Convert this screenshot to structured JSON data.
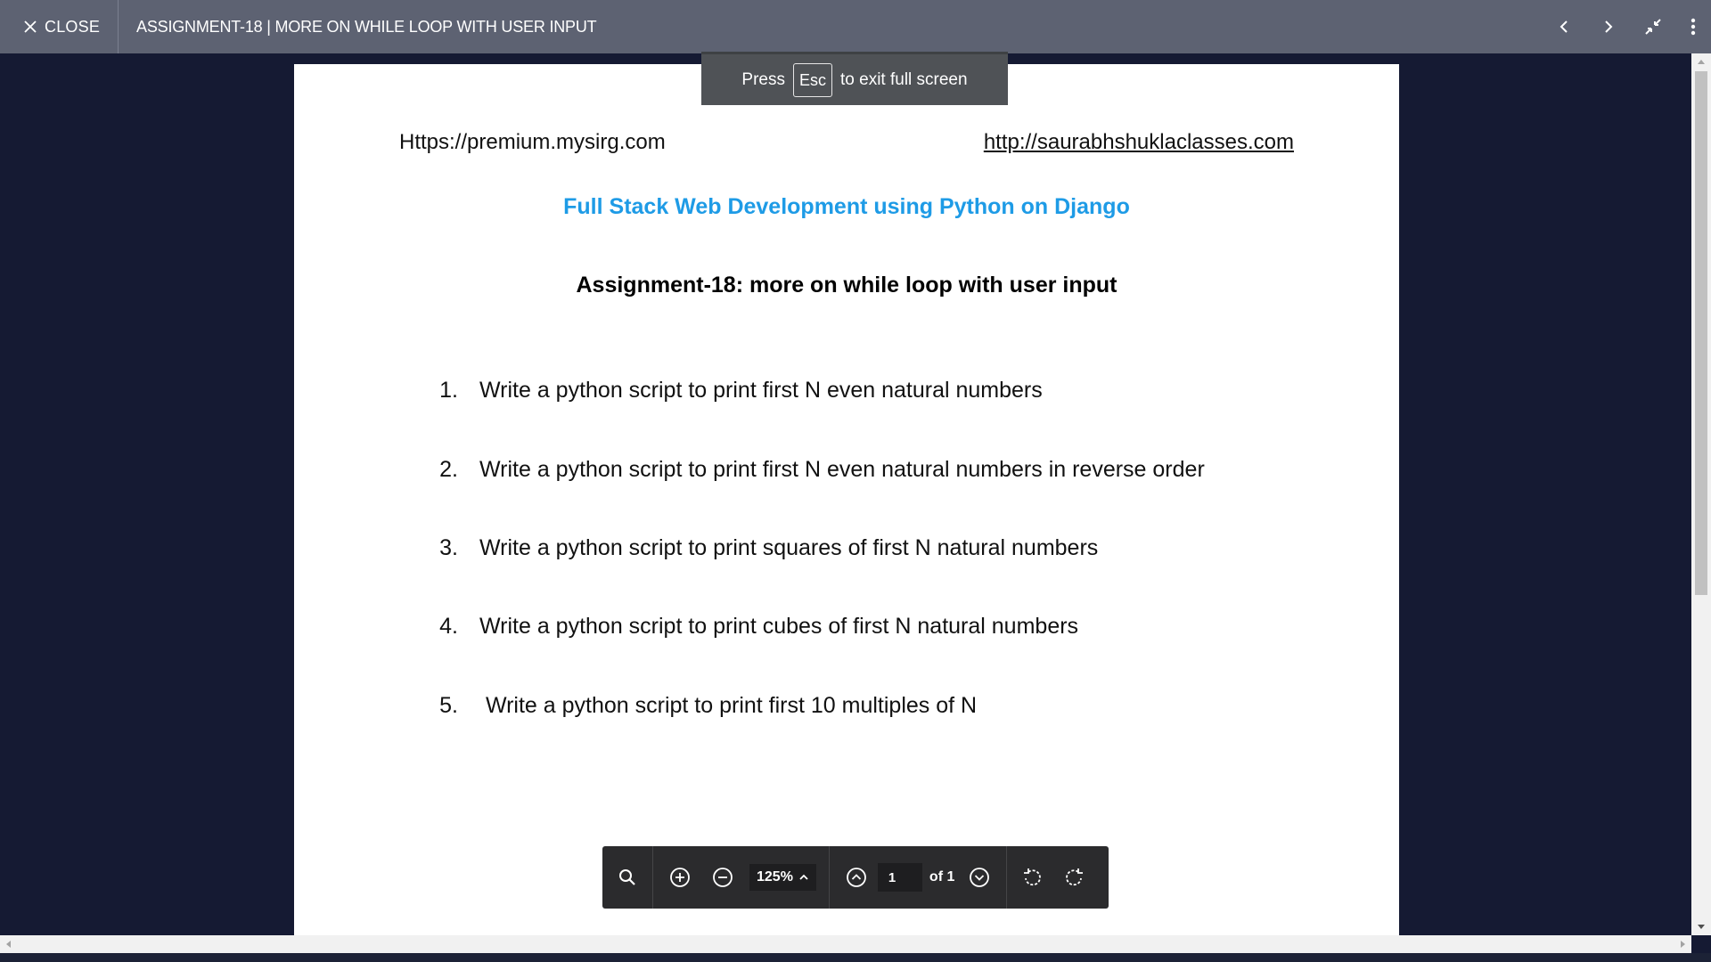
{
  "topbar": {
    "close_label": "CLOSE",
    "title": "ASSIGNMENT-18 | MORE ON WHILE LOOP WITH USER INPUT"
  },
  "toast": {
    "press": "Press",
    "key": "Esc",
    "suffix": "to exit full screen"
  },
  "document": {
    "url_left": "Https://premium.mysirg.com",
    "url_right": "http://saurabhshuklaclasses.com",
    "course_title": "Full Stack Web Development using Python on Django",
    "assignment_title": "Assignment-18: more on while loop with user input",
    "tasks": [
      {
        "num": "1.",
        "text": "Write a python script to print first N even natural numbers"
      },
      {
        "num": "2.",
        "text": "Write a python script to print first N even natural numbers in reverse order"
      },
      {
        "num": "3.",
        "text": "Write a python script to print squares of first N natural numbers"
      },
      {
        "num": "4.",
        "text": "Write a python script to print cubes of first N natural numbers"
      },
      {
        "num": "5.",
        "text": " Write a python script to print first 10 multiples of N"
      }
    ]
  },
  "toolbar": {
    "zoom": "125%",
    "page": "1",
    "of_text": "of 1"
  },
  "colors": {
    "accent_title": "#1e9be6",
    "topbar_bg": "#5d6272",
    "background": "#151a33"
  }
}
